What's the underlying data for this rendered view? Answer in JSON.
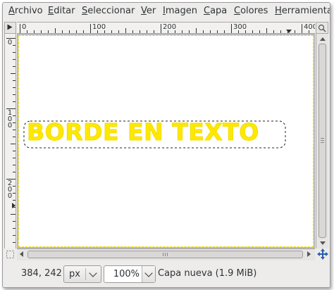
{
  "menubar": {
    "items": [
      "Archivo",
      "Editar",
      "Seleccionar",
      "Ver",
      "Imagen",
      "Capa",
      "Colores",
      "Herramientas"
    ]
  },
  "rulers": {
    "horizontal_labels": [
      "0",
      "100",
      "200",
      "300",
      "400"
    ],
    "vertical_labels": [
      "0",
      "100",
      "200"
    ]
  },
  "canvas": {
    "text": "BORDE EN TEXTO",
    "text_color": "#ffe800",
    "background": "#ffffff"
  },
  "status": {
    "coords": "384, 242",
    "unit": "px",
    "zoom": "100%",
    "layer_info": "Capa nueva (1.9 MiB)"
  },
  "icons": {
    "quick_mask": "quick-mask-icon",
    "navigate": "navigate-icon",
    "zoom_image": "zoom-image-icon"
  }
}
